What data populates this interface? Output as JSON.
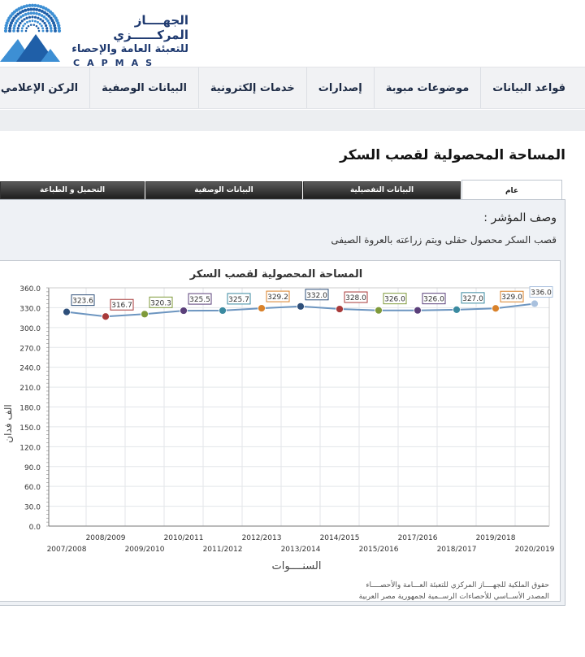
{
  "header": {
    "org_name_line1": "الجهــــاز المركــــــزي",
    "org_name_line2": "للتعبئة العامة والإحصاء",
    "org_abbr": "CAPMAS",
    "logo_icon": "dotted-pyramid-logo",
    "brand_color": "#1f3a70",
    "accent_color": "#3d8fd4"
  },
  "nav": {
    "items": [
      {
        "label": "قواعد البيانات"
      },
      {
        "label": "موضوعات مبوبة"
      },
      {
        "label": "إصدارات"
      },
      {
        "label": "خدمات إلكترونية"
      },
      {
        "label": "البيانات الوصفية"
      },
      {
        "label": "الركن الإعلامي"
      }
    ]
  },
  "page": {
    "title": "المساحة المحصولية لقصب السكر"
  },
  "tabs": [
    {
      "label": "عام",
      "active": true
    },
    {
      "label": "البيانات التفصيلية",
      "active": false
    },
    {
      "label": "البيانات الوصفية",
      "active": false
    },
    {
      "label": "التحميل و الطباعة",
      "active": false
    }
  ],
  "indicator": {
    "label": "وصف المؤشر :",
    "text": "قصب السكر محصول حقلى ويتم زراعته بالعروة الصيفى"
  },
  "chart_data": {
    "type": "line",
    "title": "المساحة المحصولية  لقصب السكر",
    "xlabel": "السنــــوات",
    "ylabel": "الف فدان",
    "ylim": [
      0,
      360
    ],
    "yticks": [
      "0.0",
      "30.0",
      "60.0",
      "90.0",
      "120.0",
      "150.0",
      "180.0",
      "210.0",
      "240.0",
      "270.0",
      "300.0",
      "330.0",
      "360.0"
    ],
    "grid": true,
    "line_color": "#6c95c0",
    "categories": [
      "2007/2008",
      "2008/2009",
      "2009/2010",
      "2010/2011",
      "2011/2012",
      "2012/2013",
      "2013/2014",
      "2014/2015",
      "2015/2016",
      "2016/2017",
      "2017/2018",
      "2018/2019",
      "2019/2020"
    ],
    "tick_labels_upper": [
      "2008/2009",
      "2010/2011",
      "2012/2013",
      "2014/2015",
      "2016/2017",
      "2018/2019"
    ],
    "tick_labels_lower": [
      "2007/2008",
      "2009/2010",
      "2011/2012",
      "2013/2014",
      "2015/2016",
      "2017/2018",
      "2019/2020"
    ],
    "tick_labels_upper_text": [
      "2008/2009",
      "2010/2011",
      "2012/2013",
      "2014/2015",
      "2017/2016",
      "2019/2018"
    ],
    "tick_labels_lower_text": [
      "2007/2008",
      "2009/2010",
      "2011/2012",
      "2013/2014",
      "2015/2016",
      "2018/2017",
      "2020/2019"
    ],
    "values": [
      323.6,
      316.7,
      320.3,
      325.5,
      325.7,
      329.2,
      332.0,
      328.0,
      326.0,
      326.0,
      327.0,
      329.0,
      336.0
    ],
    "value_labels": [
      "323.6",
      "316.7",
      "320.3",
      "325.5",
      "325.7",
      "329.2",
      "332.0",
      "328.0",
      "326.0",
      "326.0",
      "327.0",
      "329.0",
      "336.0"
    ],
    "point_colors": [
      "#2e4f7a",
      "#a83a3a",
      "#7f9a3a",
      "#5a3f7a",
      "#3a8aa0",
      "#d9822b",
      "#2e4f7a",
      "#a83a3a",
      "#7f9a3a",
      "#5a3f7a",
      "#3a8aa0",
      "#d9822b",
      "#a9c1de"
    ],
    "footnote_line1": "حقوق الملكية للجهــــاز المركزي للتعبئة العـــامة والأحصــــاء",
    "footnote_line2": "المصدر الأســاسي للأحصاءات الرســمية لجمهورية مصر العربية"
  }
}
